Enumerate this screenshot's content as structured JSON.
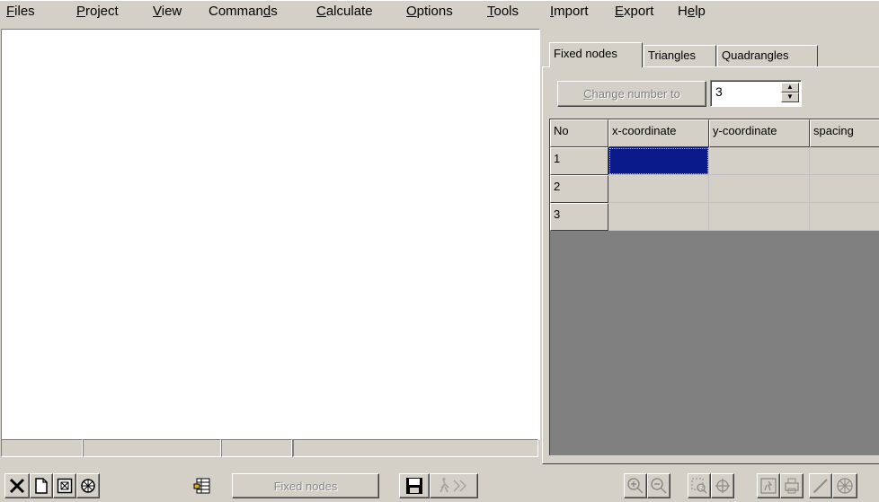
{
  "menu": [
    {
      "pre": "",
      "key": "F",
      "post": "iles"
    },
    {
      "pre": "",
      "key": "P",
      "post": "roject"
    },
    {
      "pre": "",
      "key": "V",
      "post": "iew"
    },
    {
      "pre": "Comman",
      "key": "d",
      "post": "s"
    },
    {
      "pre": "",
      "key": "C",
      "post": "alculate"
    },
    {
      "pre": "",
      "key": "O",
      "post": "ptions"
    },
    {
      "pre": "",
      "key": "T",
      "post": "ools"
    },
    {
      "pre": "",
      "key": "I",
      "post": "mport"
    },
    {
      "pre": "",
      "key": "E",
      "post": "xport"
    },
    {
      "pre": "H",
      "key": "e",
      "post": "lp"
    }
  ],
  "tabs": [
    "Fixed nodes",
    "Triangles",
    "Quadrangles"
  ],
  "change_number": {
    "label_key": "C",
    "label_rest": "hange number to",
    "value": "3"
  },
  "grid": {
    "headers": [
      "No",
      "x-coordinate",
      "y-coordinate",
      "spacing"
    ],
    "rows": [
      {
        "no": "1",
        "x": "",
        "y": "",
        "spacing": ""
      },
      {
        "no": "2",
        "x": "",
        "y": "",
        "spacing": ""
      },
      {
        "no": "3",
        "x": "",
        "y": "",
        "spacing": ""
      }
    ]
  },
  "toolbar": {
    "mode_label": "Fixed nodes"
  },
  "icons": [
    "close-icon",
    "new-page-icon",
    "frame-icon",
    "wheel-icon",
    "spreadsheet-icon",
    "save-icon",
    "run-icon",
    "zoom-in-icon",
    "zoom-out-icon",
    "zoom-window-icon",
    "pan-icon",
    "refresh-icon",
    "print-icon",
    "edit-icon",
    "mesh-icon"
  ]
}
